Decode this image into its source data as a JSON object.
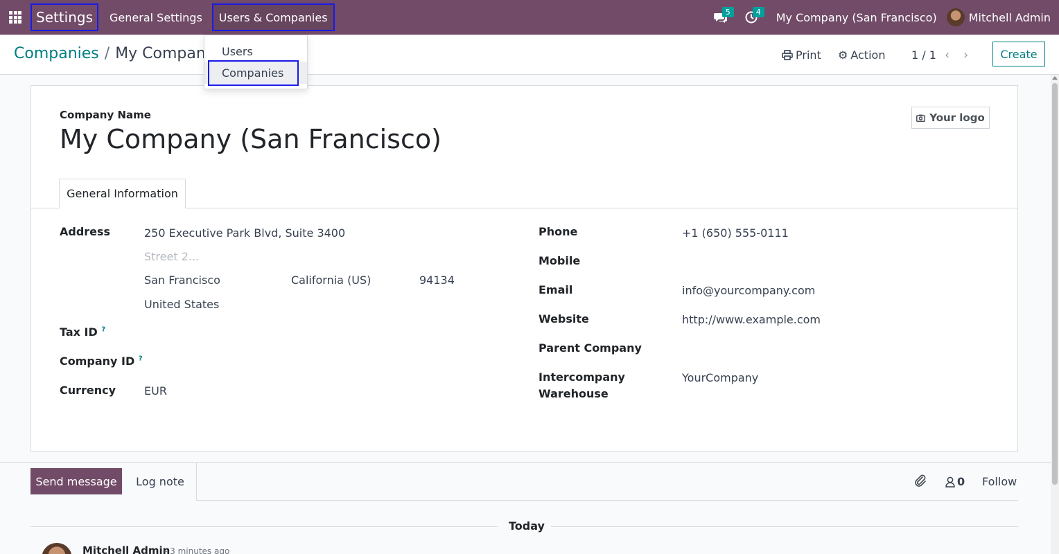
{
  "navbar": {
    "app_name": "Settings",
    "menu": [
      {
        "label": "General Settings"
      },
      {
        "label": "Users & Companies"
      }
    ],
    "messages_count": "5",
    "activities_count": "4",
    "company": "My Company (San Francisco)",
    "user": "Mitchell Admin"
  },
  "dropdown": {
    "items": [
      {
        "label": "Users"
      },
      {
        "label": "Companies"
      }
    ]
  },
  "control_panel": {
    "breadcrumb_parent": "Companies",
    "breadcrumb_sep": "/",
    "breadcrumb_current": "My Company",
    "print_label": "Print",
    "action_label": "Action",
    "pager": "1 / 1",
    "create_label": "Create"
  },
  "form": {
    "company_name_label": "Company Name",
    "company_name": "My Company (San Francisco)",
    "logo_label": "Your logo",
    "tab_label": "General Information",
    "address_label": "Address",
    "street": "250 Executive Park Blvd, Suite 3400",
    "street2_placeholder": "Street 2...",
    "city": "San Francisco",
    "state": "California (US)",
    "zip": "94134",
    "country": "United States",
    "tax_id_label": "Tax ID",
    "company_id_label": "Company ID",
    "help_mark": "?",
    "currency_label": "Currency",
    "currency": "EUR",
    "phone_label": "Phone",
    "phone": "+1 (650) 555-0111",
    "mobile_label": "Mobile",
    "email_label": "Email",
    "email": "info@yourcompany.com",
    "website_label": "Website",
    "website": "http://www.example.com",
    "parent_company_label": "Parent Company",
    "intercompany_label_1": "Intercompany",
    "intercompany_label_2": "Warehouse",
    "intercompany_value": "YourCompany"
  },
  "chatter": {
    "send_message": "Send message",
    "log_note": "Log note",
    "followers_count": "0",
    "follow_label": "Follow",
    "today_label": "Today",
    "author": "Mitchell Admin",
    "time": "- 3 minutes ago"
  },
  "colors": {
    "brand": "#714b67",
    "accent": "#017e84",
    "badge": "#00a09d",
    "highlight_frame": "#1a1ae8"
  }
}
